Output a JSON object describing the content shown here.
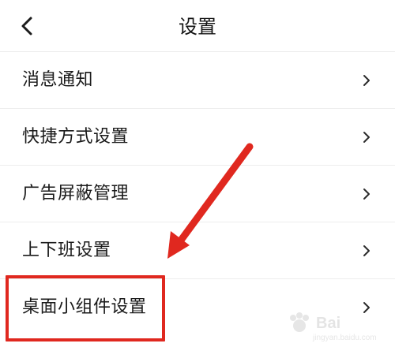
{
  "header": {
    "title": "设置",
    "back_icon": "chevron-left-icon"
  },
  "settings": {
    "items": [
      {
        "label": "消息通知",
        "icon": "chevron-right-icon"
      },
      {
        "label": "快捷方式设置",
        "icon": "chevron-right-icon"
      },
      {
        "label": "广告屏蔽管理",
        "icon": "chevron-right-icon"
      },
      {
        "label": "上下班设置",
        "icon": "chevron-right-icon"
      },
      {
        "label": "桌面小组件设置",
        "icon": "chevron-right-icon"
      }
    ]
  },
  "annotation": {
    "highlight_color": "#e0281f",
    "arrow_color": "#e0281f"
  },
  "watermark": {
    "brand": "Bai",
    "domain": "jingyan.baidu.com"
  }
}
